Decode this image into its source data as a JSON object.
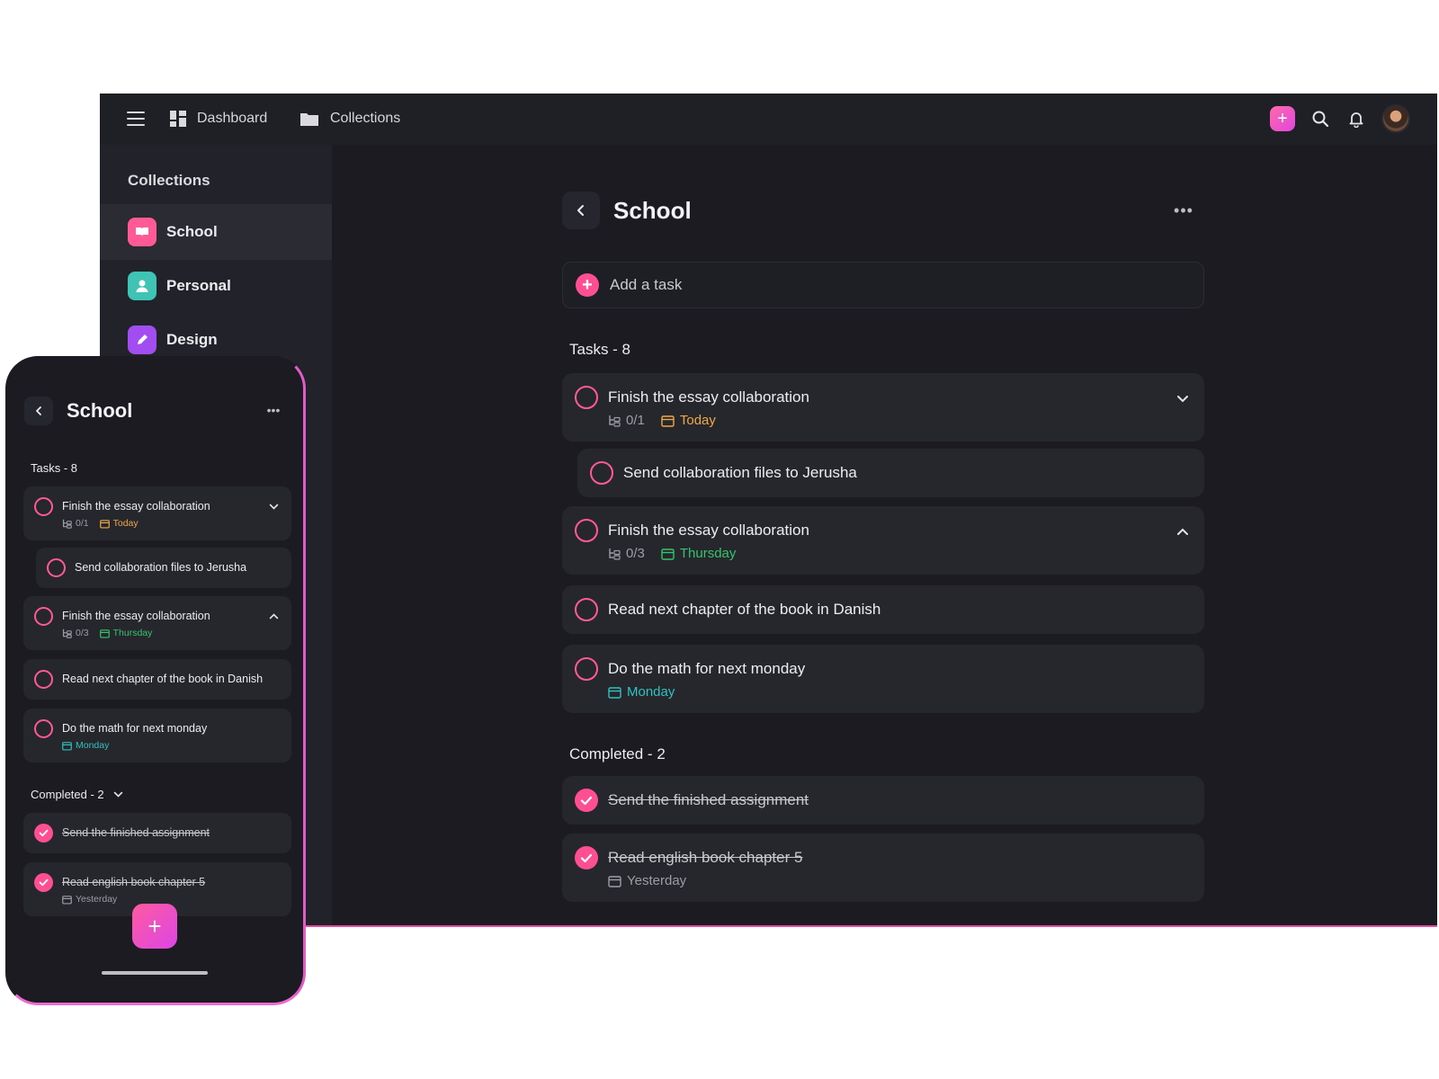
{
  "colors": {
    "accent": "#ff4f93",
    "today": "#f0a848",
    "thursday": "#36c46c",
    "monday": "#2fc2c0"
  },
  "topbar": {
    "menu_icon": "hamburger-icon",
    "dashboard_label": "Dashboard",
    "collections_label": "Collections"
  },
  "sidebar": {
    "title": "Collections",
    "items": [
      {
        "label": "School",
        "icon": "book-icon",
        "color": "#ff5a95"
      },
      {
        "label": "Personal",
        "icon": "person-icon",
        "color": "#3fc3b4"
      },
      {
        "label": "Design",
        "icon": "pencil-icon",
        "color": "#a24df0"
      }
    ]
  },
  "main": {
    "title": "School",
    "add_task_placeholder": "Add a task",
    "tasks_label": "Tasks - 8",
    "completed_label": "Completed - 2",
    "tasks": [
      {
        "title": "Finish the essay collaboration",
        "subtasks": "0/1",
        "due": "Today"
      },
      {
        "title": "Send collaboration files to Jerusha"
      },
      {
        "title": "Finish the essay collaboration",
        "subtasks": "0/3",
        "due": "Thursday"
      },
      {
        "title": "Read next chapter of the book in Danish"
      },
      {
        "title": "Do the math for next monday",
        "due": "Monday"
      }
    ],
    "completed": [
      {
        "title": "Send the finished assignment"
      },
      {
        "title": "Read english book chapter 5",
        "due": "Yesterday"
      }
    ]
  },
  "phone": {
    "title": "School",
    "tasks_label": "Tasks - 8",
    "completed_label": "Completed - 2"
  }
}
